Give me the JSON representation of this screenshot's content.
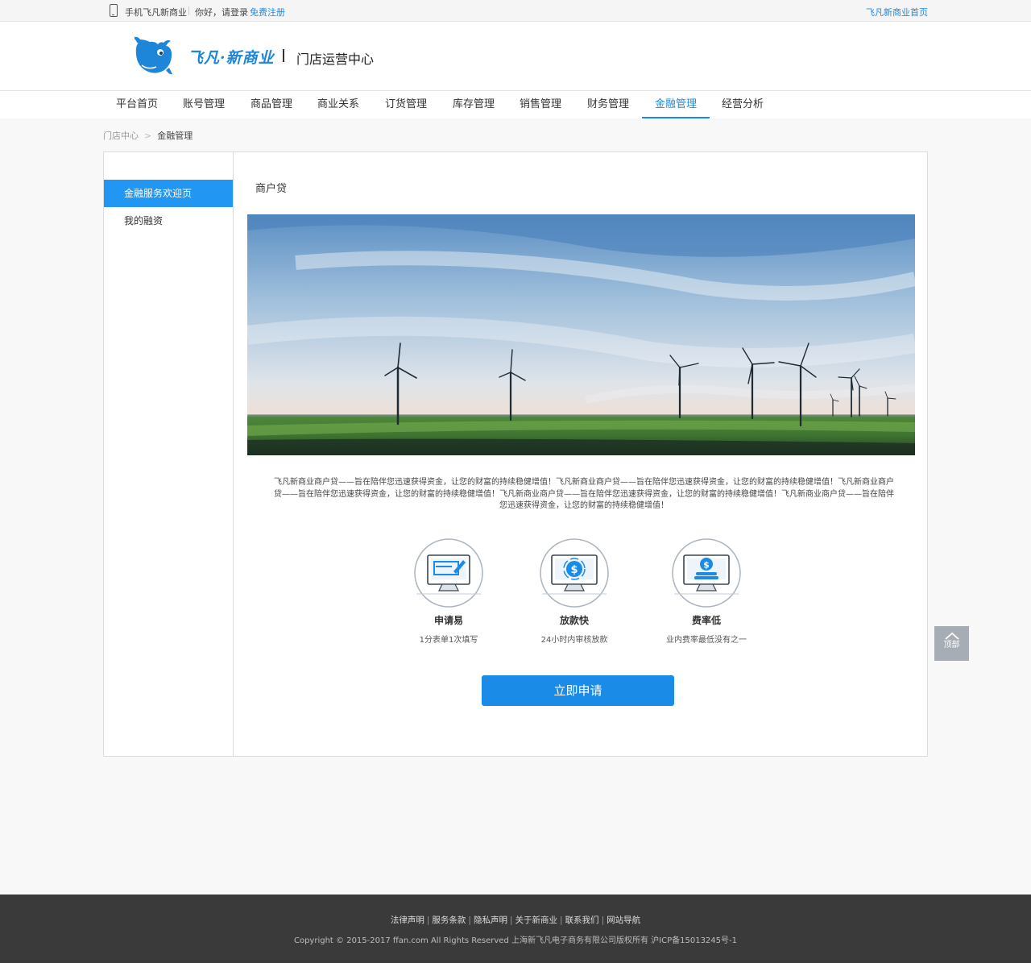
{
  "topbar": {
    "mobile_label": "手机飞凡新商业",
    "greeting": "你好，请登录",
    "register": "免费注册",
    "home_link": "飞凡新商业首页"
  },
  "header": {
    "brand": "飞凡·新商业",
    "center_title": "门店运营中心"
  },
  "nav": {
    "items": [
      "平台首页",
      "账号管理",
      "商品管理",
      "商业关系",
      "订货管理",
      "库存管理",
      "销售管理",
      "财务管理",
      "金融管理",
      "经营分析"
    ],
    "active": "金融管理"
  },
  "breadcrumb": {
    "root": "门店中心",
    "separator": ">",
    "current": "金融管理"
  },
  "sidebar": {
    "items": [
      "金融服务欢迎页",
      "我的融资"
    ],
    "active": "金融服务欢迎页"
  },
  "main": {
    "section_title": "商户贷",
    "description": "飞凡新商业商户贷——旨在陪伴您迅速获得资金，让您的财富的持续稳健增值！飞凡新商业商户贷——旨在陪伴您迅速获得资金，让您的财富的持续稳健增值！飞凡新商业商户贷——旨在陪伴您迅速获得资金，让您的财富的持续稳健增值！飞凡新商业商户贷——旨在陪伴您迅速获得资金，让您的财富的持续稳健增值！飞凡新商业商户贷——旨在陪伴您迅速获得资金，让您的财富的持续稳健增值！",
    "features": [
      {
        "title": "申请易",
        "subtitle": "1分表单1次填写",
        "icon": "form-edit-icon"
      },
      {
        "title": "放款快",
        "subtitle": "24小时内审核放款",
        "icon": "fast-money-icon"
      },
      {
        "title": "费率低",
        "subtitle": "业内费率最低没有之一",
        "icon": "coin-stack-icon"
      }
    ],
    "apply_button": "立即申请"
  },
  "back_to_top": "顶部",
  "footer": {
    "links": [
      "法律声明",
      "服务条款",
      "隐私声明",
      "关于新商业",
      "联系我们",
      "网站导航"
    ],
    "copyright": "Copyright © 2015-2017 ffan.com All Rights Reserved 上海新飞凡电子商务有限公司版权所有 沪ICP备15013245号-1"
  },
  "colors": {
    "accent": "#1a8be6",
    "sidebar_active": "#2196f3",
    "footer_bg": "#3a3a3a",
    "page_bg": "#f8f8f8"
  }
}
